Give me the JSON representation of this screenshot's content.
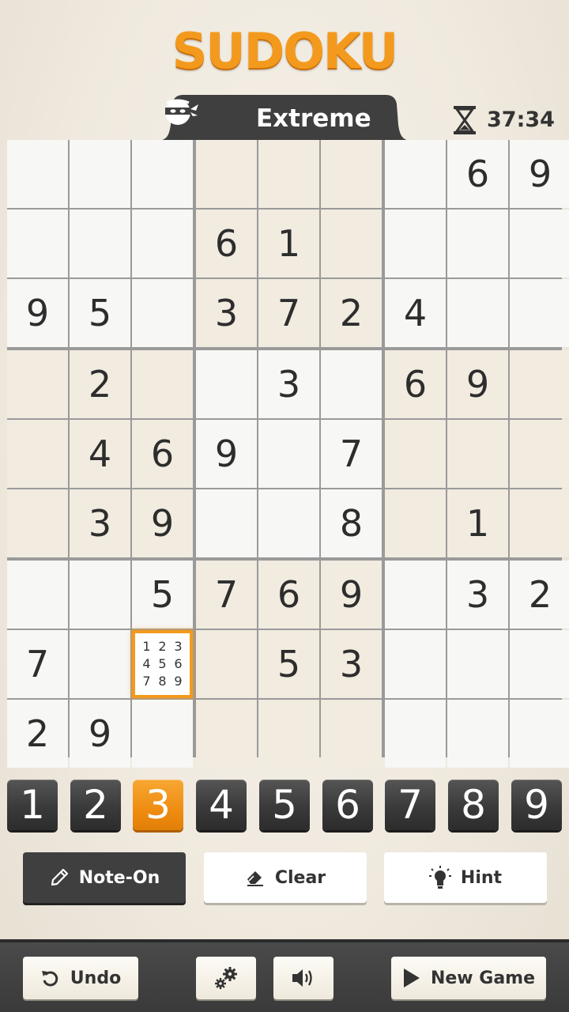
{
  "app": {
    "logo": "SUDOKU"
  },
  "header": {
    "difficulty": "Extreme",
    "timer": "37:34"
  },
  "board": {
    "rows": [
      [
        "",
        "",
        "",
        "",
        "",
        "",
        "",
        "6",
        "9"
      ],
      [
        "",
        "",
        "",
        "6",
        "1",
        "",
        "",
        "",
        ""
      ],
      [
        "9",
        "5",
        "",
        "3",
        "7",
        "2",
        "4",
        "",
        ""
      ],
      [
        "",
        "2",
        "",
        "",
        "3",
        "",
        "6",
        "9",
        ""
      ],
      [
        "",
        "4",
        "6",
        "9",
        "",
        "7",
        "",
        "",
        ""
      ],
      [
        "",
        "3",
        "9",
        "",
        "",
        "8",
        "",
        "1",
        ""
      ],
      [
        "",
        "",
        "5",
        "7",
        "6",
        "9",
        "",
        "3",
        "2"
      ],
      [
        "7",
        "",
        "",
        "",
        "5",
        "3",
        "",
        "",
        ""
      ],
      [
        "2",
        "9",
        "",
        "",
        "",
        "",
        "",
        "",
        ""
      ]
    ],
    "selected_cell": {
      "row": 8,
      "col": 3
    },
    "selected_notes": [
      "1",
      "2",
      "3",
      "4",
      "5",
      "6",
      "7",
      "8",
      "9"
    ]
  },
  "numpad": {
    "keys": [
      "1",
      "2",
      "3",
      "4",
      "5",
      "6",
      "7",
      "8",
      "9"
    ],
    "active": "3"
  },
  "tools": {
    "note": {
      "label": "Note-On",
      "icon": "pencil-icon"
    },
    "clear": {
      "label": "Clear",
      "icon": "eraser-icon"
    },
    "hint": {
      "label": "Hint",
      "icon": "lightbulb-icon"
    }
  },
  "footer": {
    "undo": {
      "label": "Undo",
      "icon": "undo-icon"
    },
    "settings": {
      "icon": "gears-icon"
    },
    "sound": {
      "icon": "speaker-icon"
    },
    "new_game": {
      "label": "New Game",
      "icon": "play-icon"
    }
  },
  "colors": {
    "accent": "#f39a1e",
    "dark_key": "#3a3a3a",
    "tint_block": "#f1ebe0",
    "light_block": "#f7f7f6"
  }
}
